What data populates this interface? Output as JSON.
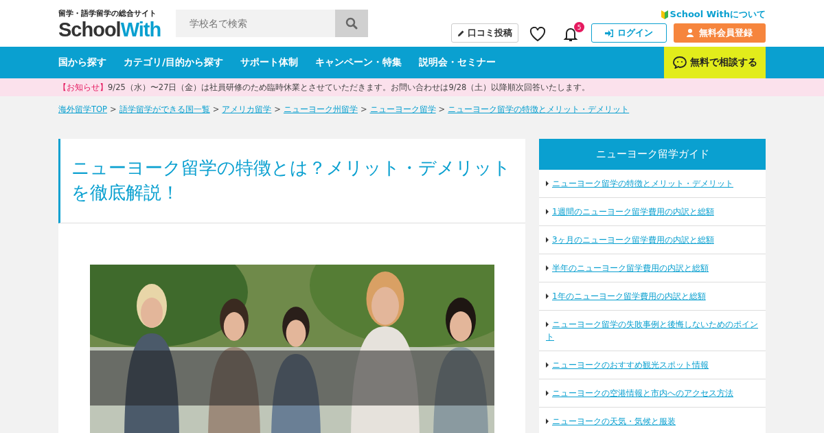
{
  "header": {
    "tagline": "留学・語学留学の総合サイト",
    "logo_1": "School",
    "logo_2": "With",
    "search": {
      "placeholder": "学校名で検索"
    },
    "about_link": "School Withについて",
    "review_button": "口コミ投稿",
    "notification_count": "5",
    "login_button": "ログイン",
    "signup_button": "無料会員登録"
  },
  "nav": {
    "items": [
      "国から探す",
      "カテゴリ/目的から探す",
      "サポート体制",
      "キャンペーン・特集",
      "説明会・セミナー"
    ],
    "consult_button": "無料で相談する"
  },
  "notice": {
    "label": "【お知らせ】",
    "text": "9/25（水）〜27日（金）は社員研修のため臨時休業とさせていただきます。お問い合わせは9/28（土）以降順次回答いたします。"
  },
  "breadcrumbs": [
    {
      "label": "海外留学TOP",
      "separator": ">"
    },
    {
      "label": "語学留学ができる国一覧",
      "separator": ">"
    },
    {
      "label": "アメリカ留学",
      "separator": ">"
    },
    {
      "label": "ニューヨーク州留学",
      "separator": ">"
    },
    {
      "label": "ニューヨーク留学",
      "separator": ">"
    },
    {
      "label": "ニューヨーク留学の特徴とメリット・デメリット"
    }
  ],
  "article": {
    "title": "ニューヨーク留学の特徴とは？メリット・デメリットを徹底解説！"
  },
  "sidebar": {
    "title": "ニューヨーク留学ガイド",
    "items": [
      "ニューヨーク留学の特徴とメリット・デメリット",
      "1週間のニューヨーク留学費用の内訳と総額",
      "3ヶ月のニューヨーク留学費用の内訳と総額",
      "半年のニューヨーク留学費用の内訳と総額",
      "1年のニューヨーク留学費用の内訳と総額",
      "ニューヨーク留学の失敗事例と後悔しないためのポイント",
      "ニューヨークのおすすめ観光スポット情報",
      "ニューヨークの空港情報と市内へのアクセス方法",
      "ニューヨークの天気・気候と服装"
    ]
  }
}
